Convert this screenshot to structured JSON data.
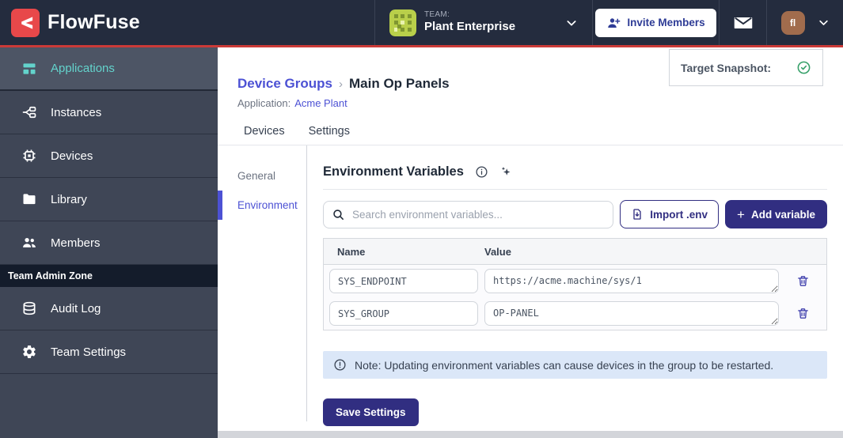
{
  "header": {
    "brand": "FlowFuse",
    "team_label": "TEAM:",
    "team_name": "Plant Enterprise",
    "invite_button": "Invite Members",
    "avatar_initials": "fl"
  },
  "sidebar": {
    "items": [
      {
        "label": "Applications",
        "active": true
      },
      {
        "label": "Instances",
        "active": false
      },
      {
        "label": "Devices",
        "active": false
      },
      {
        "label": "Library",
        "active": false
      },
      {
        "label": "Members",
        "active": false
      }
    ],
    "admin_zone_label": "Team Admin Zone",
    "admin_items": [
      {
        "label": "Audit Log"
      },
      {
        "label": "Team Settings"
      }
    ]
  },
  "breadcrumb": {
    "parent": "Device Groups",
    "separator": "›",
    "current": "Main Op Panels"
  },
  "application": {
    "label": "Application:",
    "name": "Acme Plant"
  },
  "target_snapshot": {
    "label": "Target Snapshot:"
  },
  "tabs": [
    {
      "label": "Devices"
    },
    {
      "label": "Settings"
    }
  ],
  "subnav": [
    {
      "label": "General",
      "active": false
    },
    {
      "label": "Environment",
      "active": true
    }
  ],
  "env": {
    "title": "Environment Variables",
    "search_placeholder": "Search environment variables...",
    "import_button": "Import .env",
    "add_button": "Add variable",
    "add_plus": "+",
    "table": {
      "headers": [
        "Name",
        "Value"
      ],
      "rows": [
        {
          "name": "SYS_ENDPOINT",
          "value": "https://acme.machine/sys/1"
        },
        {
          "name": "SYS_GROUP",
          "value": "OP-PANEL"
        }
      ]
    },
    "note": "Note: Updating environment variables can cause devices in the group to be restarted.",
    "save_button": "Save Settings"
  },
  "colors": {
    "header_bg": "#242c3e",
    "accent_red": "#cb3a38",
    "sidebar_bg": "#3f4656",
    "active_teal": "#63d3cc",
    "link_indigo": "#4c51d4",
    "button_indigo": "#312e81",
    "note_bg": "#dbe7f8",
    "snapshot_check_green": "#36a069",
    "avatar_bg": "#a16c4d"
  }
}
